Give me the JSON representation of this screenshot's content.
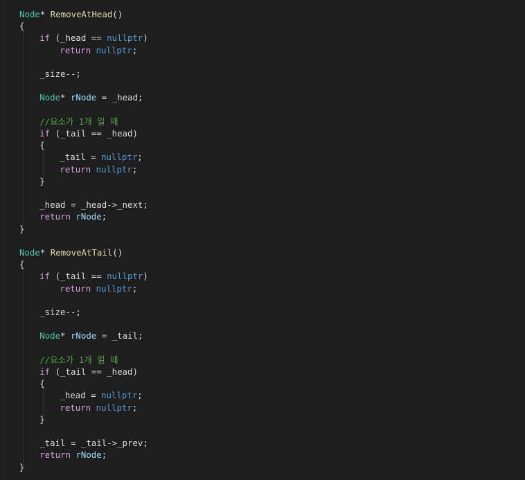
{
  "editor": {
    "language": "C++",
    "theme_colors": {
      "background": "#1e1e1e",
      "type": "#4ec9b0",
      "control_keyword": "#d8a0df",
      "literal_keyword": "#569cd6",
      "function": "#dcdcaa",
      "local_variable": "#9cdcfe",
      "comment": "#57a64a",
      "plain": "#dcdcdc"
    },
    "lines": [
      {
        "indent": 0,
        "tokens": [
          {
            "t": "Node",
            "c": "type"
          },
          {
            "t": "* ",
            "c": "plain"
          },
          {
            "t": "RemoveAtHead",
            "c": "func"
          },
          {
            "t": "()",
            "c": "plain"
          }
        ]
      },
      {
        "indent": 0,
        "tokens": [
          {
            "t": "{",
            "c": "plain"
          }
        ]
      },
      {
        "indent": 1,
        "tokens": [
          {
            "t": "if",
            "c": "kw"
          },
          {
            "t": " (_head == ",
            "c": "plain"
          },
          {
            "t": "nullptr",
            "c": "lit"
          },
          {
            "t": ")",
            "c": "plain"
          }
        ]
      },
      {
        "indent": 2,
        "tokens": [
          {
            "t": "return",
            "c": "kw"
          },
          {
            "t": " ",
            "c": "plain"
          },
          {
            "t": "nullptr",
            "c": "lit"
          },
          {
            "t": ";",
            "c": "plain"
          }
        ]
      },
      {
        "indent": 0,
        "tokens": []
      },
      {
        "indent": 1,
        "tokens": [
          {
            "t": "_size--;",
            "c": "plain"
          }
        ]
      },
      {
        "indent": 0,
        "tokens": []
      },
      {
        "indent": 1,
        "tokens": [
          {
            "t": "Node",
            "c": "type"
          },
          {
            "t": "* ",
            "c": "plain"
          },
          {
            "t": "rNode",
            "c": "param"
          },
          {
            "t": " = _head;",
            "c": "plain"
          }
        ]
      },
      {
        "indent": 0,
        "tokens": []
      },
      {
        "indent": 1,
        "tokens": [
          {
            "t": "//요소가 1개 일 때",
            "c": "cmt"
          }
        ]
      },
      {
        "indent": 1,
        "tokens": [
          {
            "t": "if",
            "c": "kw"
          },
          {
            "t": " (_tail == _head)",
            "c": "plain"
          }
        ]
      },
      {
        "indent": 1,
        "tokens": [
          {
            "t": "{",
            "c": "plain"
          }
        ]
      },
      {
        "indent": 2,
        "tokens": [
          {
            "t": "_tail = ",
            "c": "plain"
          },
          {
            "t": "nullptr",
            "c": "lit"
          },
          {
            "t": ";",
            "c": "plain"
          }
        ]
      },
      {
        "indent": 2,
        "tokens": [
          {
            "t": "return",
            "c": "kw"
          },
          {
            "t": " ",
            "c": "plain"
          },
          {
            "t": "nullptr",
            "c": "lit"
          },
          {
            "t": ";",
            "c": "plain"
          }
        ]
      },
      {
        "indent": 1,
        "tokens": [
          {
            "t": "}",
            "c": "plain"
          }
        ]
      },
      {
        "indent": 0,
        "tokens": []
      },
      {
        "indent": 1,
        "tokens": [
          {
            "t": "_head = _head->_next;",
            "c": "plain"
          }
        ]
      },
      {
        "indent": 1,
        "tokens": [
          {
            "t": "return",
            "c": "kw"
          },
          {
            "t": " ",
            "c": "plain"
          },
          {
            "t": "rNode",
            "c": "param"
          },
          {
            "t": ";",
            "c": "plain"
          }
        ]
      },
      {
        "indent": 0,
        "tokens": [
          {
            "t": "}",
            "c": "plain"
          }
        ]
      },
      {
        "indent": 0,
        "tokens": []
      },
      {
        "indent": 0,
        "tokens": [
          {
            "t": "Node",
            "c": "type"
          },
          {
            "t": "* ",
            "c": "plain"
          },
          {
            "t": "RemoveAtTail",
            "c": "func"
          },
          {
            "t": "()",
            "c": "plain"
          }
        ]
      },
      {
        "indent": 0,
        "tokens": [
          {
            "t": "{",
            "c": "plain"
          }
        ]
      },
      {
        "indent": 1,
        "tokens": [
          {
            "t": "if",
            "c": "kw"
          },
          {
            "t": " (_tail == ",
            "c": "plain"
          },
          {
            "t": "nullptr",
            "c": "lit"
          },
          {
            "t": ")",
            "c": "plain"
          }
        ]
      },
      {
        "indent": 2,
        "tokens": [
          {
            "t": "return",
            "c": "kw"
          },
          {
            "t": " ",
            "c": "plain"
          },
          {
            "t": "nullptr",
            "c": "lit"
          },
          {
            "t": ";",
            "c": "plain"
          }
        ]
      },
      {
        "indent": 0,
        "tokens": []
      },
      {
        "indent": 1,
        "tokens": [
          {
            "t": "_size--;",
            "c": "plain"
          }
        ]
      },
      {
        "indent": 0,
        "tokens": []
      },
      {
        "indent": 1,
        "tokens": [
          {
            "t": "Node",
            "c": "type"
          },
          {
            "t": "* ",
            "c": "plain"
          },
          {
            "t": "rNode",
            "c": "param"
          },
          {
            "t": " = _tail;",
            "c": "plain"
          }
        ]
      },
      {
        "indent": 0,
        "tokens": []
      },
      {
        "indent": 1,
        "tokens": [
          {
            "t": "//요소가 1개 일 때",
            "c": "cmt"
          }
        ]
      },
      {
        "indent": 1,
        "tokens": [
          {
            "t": "if",
            "c": "kw"
          },
          {
            "t": " (_tail == _head)",
            "c": "plain"
          }
        ]
      },
      {
        "indent": 1,
        "tokens": [
          {
            "t": "{",
            "c": "plain"
          }
        ]
      },
      {
        "indent": 2,
        "tokens": [
          {
            "t": "_head = ",
            "c": "plain"
          },
          {
            "t": "nullptr",
            "c": "lit"
          },
          {
            "t": ";",
            "c": "plain"
          }
        ]
      },
      {
        "indent": 2,
        "tokens": [
          {
            "t": "return",
            "c": "kw"
          },
          {
            "t": " ",
            "c": "plain"
          },
          {
            "t": "nullptr",
            "c": "lit"
          },
          {
            "t": ";",
            "c": "plain"
          }
        ]
      },
      {
        "indent": 1,
        "tokens": [
          {
            "t": "}",
            "c": "plain"
          }
        ]
      },
      {
        "indent": 0,
        "tokens": []
      },
      {
        "indent": 1,
        "tokens": [
          {
            "t": "_tail = _tail->_prev;",
            "c": "plain"
          }
        ]
      },
      {
        "indent": 1,
        "tokens": [
          {
            "t": "return",
            "c": "kw"
          },
          {
            "t": " ",
            "c": "plain"
          },
          {
            "t": "rNode",
            "c": "param"
          },
          {
            "t": ";",
            "c": "plain"
          }
        ]
      },
      {
        "indent": 0,
        "tokens": [
          {
            "t": "}",
            "c": "plain"
          }
        ]
      }
    ]
  }
}
